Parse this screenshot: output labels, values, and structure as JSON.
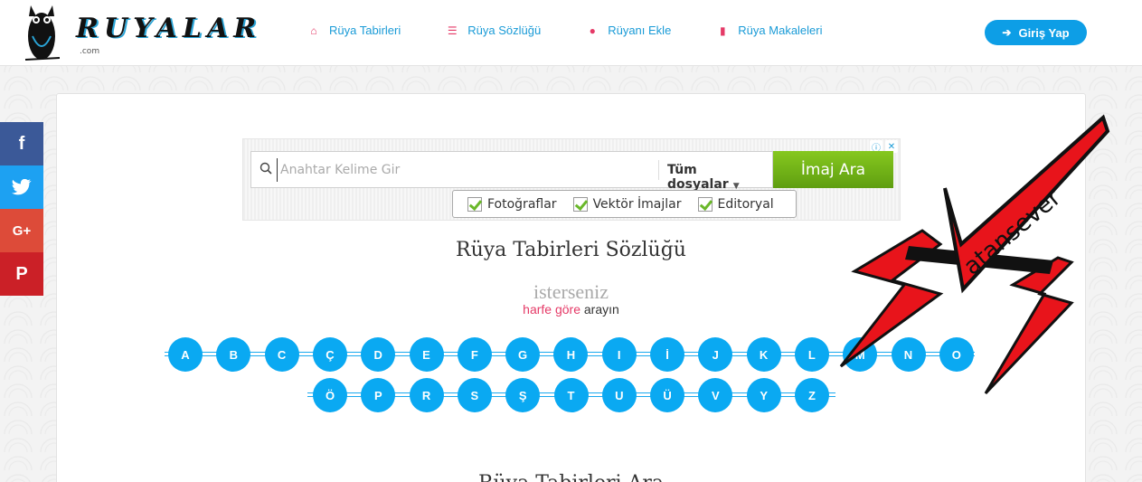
{
  "header": {
    "logo_text": "RUYALAR",
    "logo_sub": ".com",
    "nav": [
      {
        "label": "Rüya Tabirleri",
        "icon": "home-icon"
      },
      {
        "label": "Rüya Sözlüğü",
        "icon": "list-icon"
      },
      {
        "label": "Rüyanı Ekle",
        "icon": "comments-icon"
      },
      {
        "label": "Rüya Makaleleri",
        "icon": "bookmark-icon"
      }
    ],
    "login_label": "Giriş Yap"
  },
  "social": [
    {
      "label": "f",
      "name": "facebook"
    },
    {
      "label": "🐦",
      "name": "twitter"
    },
    {
      "label": "G+",
      "name": "google-plus"
    },
    {
      "label": "P",
      "name": "pinterest"
    }
  ],
  "ad": {
    "placeholder": "Anahtar Kelime Gir",
    "dropdown": "Tüm dosyalar",
    "button": "İmaj Ara",
    "options": [
      "Fotoğraflar",
      "Vektör İmajlar",
      "Editoryal"
    ]
  },
  "dictionary": {
    "title": "Rüya Tabirleri Sözlüğü",
    "grey_text": "isterseniz",
    "line_pink": "harfe göre",
    "line_rest": " arayın"
  },
  "letters_row1": [
    "A",
    "B",
    "C",
    "Ç",
    "D",
    "E",
    "F",
    "G",
    "H",
    "I",
    "İ",
    "J",
    "K",
    "L",
    "M",
    "N",
    "O"
  ],
  "letters_row2": [
    "Ö",
    "P",
    "R",
    "S",
    "Ş",
    "T",
    "U",
    "Ü",
    "V",
    "Y",
    "Z"
  ],
  "bottom_title": "Rüya Tabirleri Ara",
  "watermark_text": "atansever",
  "colors": {
    "accent": "#0aa9f2",
    "pink": "#e53a67",
    "button": "#0d9ee6"
  }
}
